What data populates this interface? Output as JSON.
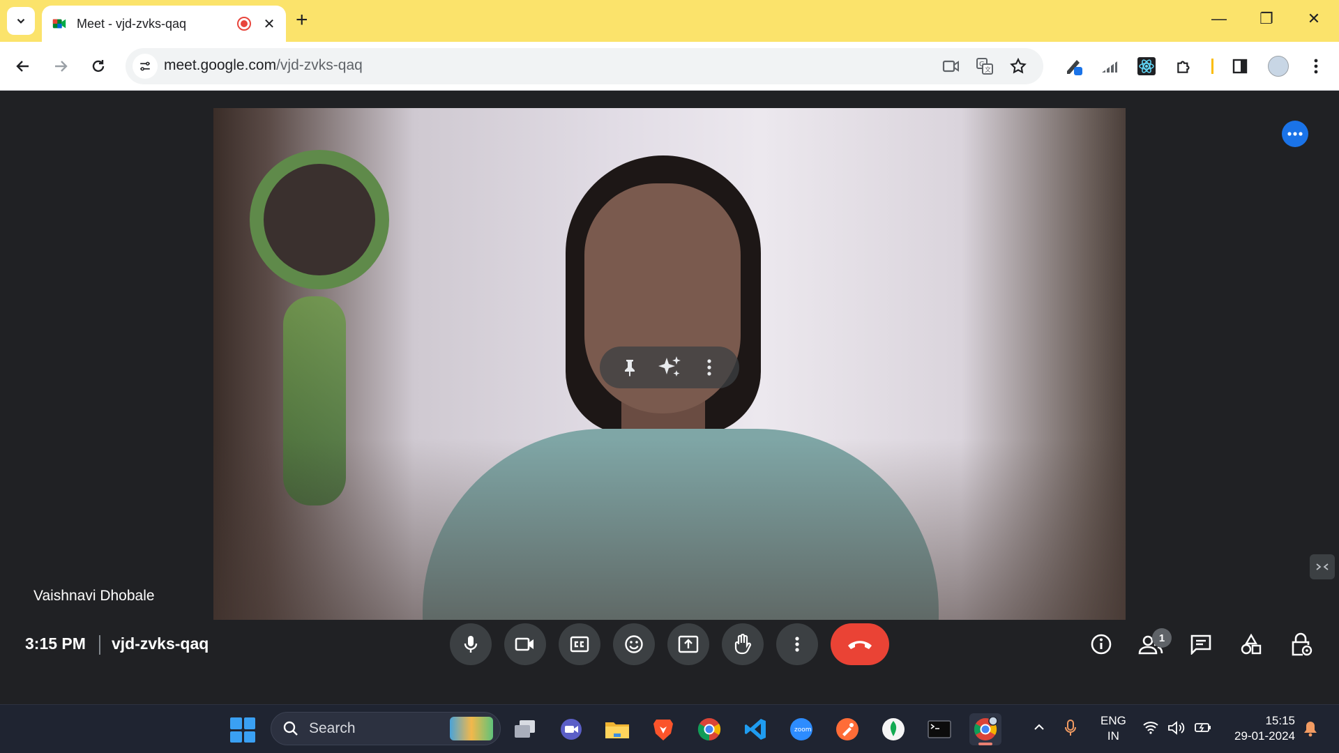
{
  "browser": {
    "tab": {
      "title": "Meet - vjd-zvks-qaq"
    },
    "url": {
      "domain": "meet.google.com",
      "path": "/vjd-zvks-qaq"
    }
  },
  "meet": {
    "participant_name": "Vaishnavi Dhobale",
    "time": "3:15 PM",
    "meeting_code": "vjd-zvks-qaq",
    "people_count": "1",
    "controls": [
      "microphone",
      "camera",
      "captions",
      "reactions",
      "present",
      "raise-hand",
      "more-options",
      "leave-call"
    ],
    "side_controls": [
      "meeting-details",
      "people",
      "chat",
      "activities",
      "host-controls"
    ],
    "accent_color": "#1a73e8",
    "leave_color": "#ea4335"
  },
  "taskbar": {
    "search_label": "Search",
    "language": {
      "line1": "ENG",
      "line2": "IN"
    },
    "clock": {
      "time": "15:15",
      "date": "29-01-2024"
    },
    "apps": [
      "task-view",
      "meet-app",
      "file-explorer",
      "brave",
      "chrome",
      "vscode",
      "zoom",
      "postman",
      "mongodb-compass",
      "terminal",
      "chrome-profile"
    ]
  }
}
